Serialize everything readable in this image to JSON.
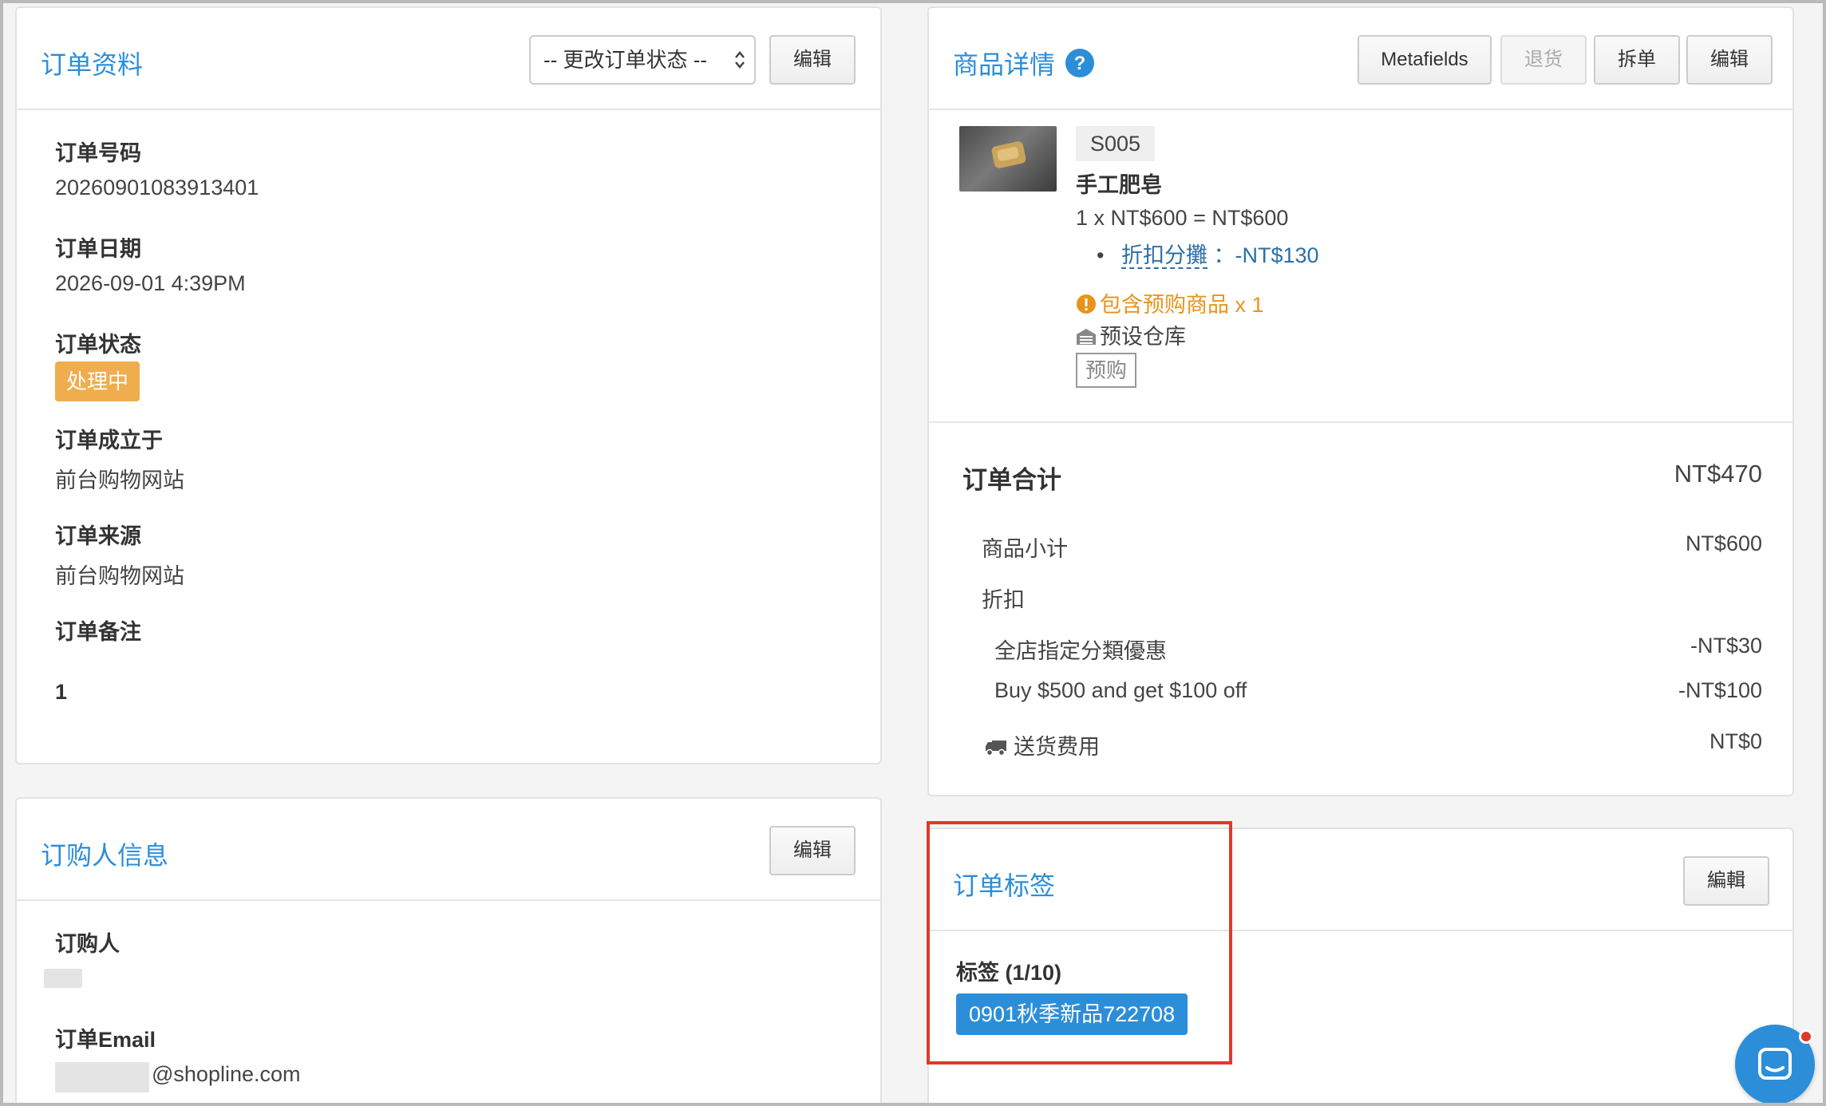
{
  "order_info": {
    "title": "订单资料",
    "status_select": "-- 更改订单状态 --",
    "edit_button": "编辑",
    "fields": [
      {
        "label": "订单号码",
        "value": "20260901083913401"
      },
      {
        "label": "订单日期",
        "value": "2026-09-01 4:39PM"
      },
      {
        "label": "订单状态",
        "value": "处理中"
      },
      {
        "label": "订单成立于",
        "value": "前台购物网站"
      },
      {
        "label": "订单来源",
        "value": "前台购物网站"
      },
      {
        "label": "订单备注",
        "value": "1"
      }
    ]
  },
  "buyer_info": {
    "title": "订购人信息",
    "edit_button": "编辑",
    "buyer_label": "订购人",
    "email_label": "订单Email",
    "email_suffix": "@shopline.com"
  },
  "product_details": {
    "title": "商品详情",
    "help_icon": "question-circle-icon",
    "buttons": {
      "metafields": "Metafields",
      "return": "退货",
      "split": "拆单",
      "edit": "编辑"
    },
    "item": {
      "sku": "S005",
      "name": "手工肥皂",
      "price_line": "1 x NT$600 = NT$600",
      "discount_link": "折扣分攤",
      "discount_value": "：-NT$130",
      "preorder_notice": "包含预购商品 x 1",
      "warehouse": "预设仓库",
      "preorder_tag": "预购"
    }
  },
  "order_total": {
    "label": "订单合计",
    "value": "NT$470",
    "rows": {
      "subtotal_label": "商品小计",
      "subtotal_value": "NT$600",
      "discount_label": "折扣",
      "discount1_label": "全店指定分類優惠",
      "discount1_value": "-NT$30",
      "discount2_label": "Buy $500 and get $100 off",
      "discount2_value": "-NT$100",
      "shipping_label": "送货费用",
      "shipping_value": "NT$0"
    }
  },
  "order_tags": {
    "title": "订单标签",
    "edit_button": "編輯",
    "tags_label": "标签 (1/10)",
    "tag": "0901秋季新品722708"
  },
  "colors": {
    "accent": "#2c8ed8",
    "warning": "#f0ad4e",
    "preorder_text": "#e8941a",
    "tag_bg": "#2c8ed8",
    "highlight": "#e0392b",
    "chat_button": "#2c8ed8"
  }
}
